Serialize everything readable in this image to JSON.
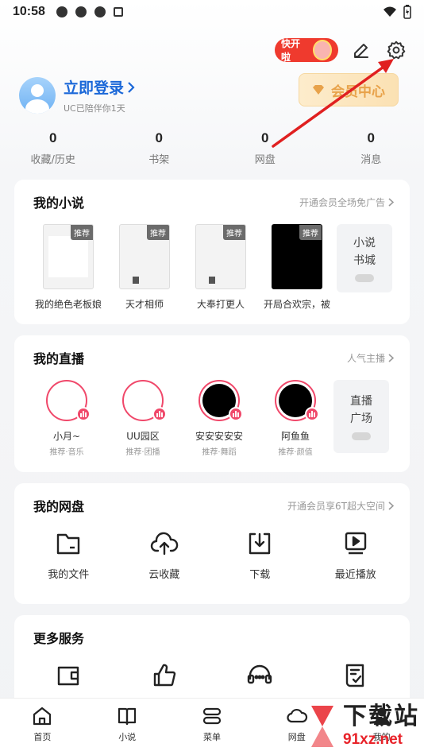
{
  "status": {
    "time": "10:58"
  },
  "header": {
    "promo_label": "快开啦",
    "login_label": "立即登录",
    "login_sub": "UC已陪伴你1天",
    "vip_label": "会员中心"
  },
  "stats": [
    {
      "value": "0",
      "label": "收藏/历史"
    },
    {
      "value": "0",
      "label": "书架"
    },
    {
      "value": "0",
      "label": "网盘"
    },
    {
      "value": "0",
      "label": "消息"
    }
  ],
  "novels": {
    "title": "我的小说",
    "link": "开通会员全场免广告",
    "items": [
      {
        "tag": "推荐",
        "name": "我的绝色老板娘"
      },
      {
        "tag": "推荐",
        "name": "天才相师"
      },
      {
        "tag": "推荐",
        "name": "大奉打更人"
      },
      {
        "tag": "推荐",
        "name": "开局合欢宗，被"
      }
    ],
    "more_line1": "小说",
    "more_line2": "书城"
  },
  "live": {
    "title": "我的直播",
    "link": "人气主播",
    "items": [
      {
        "name": "小月~",
        "sub": "推荐·音乐"
      },
      {
        "name": "UU园区",
        "sub": "推荐·团播"
      },
      {
        "name": "安安安安安",
        "sub": "推荐·舞蹈"
      },
      {
        "name": "阿鱼鱼",
        "sub": "推荐·颜值"
      }
    ],
    "more_line1": "直播",
    "more_line2": "广场"
  },
  "disk": {
    "title": "我的网盘",
    "link": "开通会员享6T超大空间",
    "items": [
      {
        "label": "我的文件",
        "icon": "folder-icon"
      },
      {
        "label": "云收藏",
        "icon": "cloud-upload-icon"
      },
      {
        "label": "下载",
        "icon": "download-icon"
      },
      {
        "label": "最近播放",
        "icon": "play-screen-icon"
      }
    ]
  },
  "services": {
    "title": "更多服务",
    "items": [
      {
        "icon": "wallet-icon"
      },
      {
        "icon": "thumbs-up-icon"
      },
      {
        "icon": "headset-icon"
      },
      {
        "icon": "checklist-icon"
      }
    ]
  },
  "nav": [
    {
      "label": "首页",
      "icon": "home-icon"
    },
    {
      "label": "小说",
      "icon": "book-icon"
    },
    {
      "label": "菜单",
      "icon": "menu-icon"
    },
    {
      "label": "网盘",
      "icon": "cloud-icon"
    },
    {
      "label": "我的",
      "icon": "user-icon"
    }
  ],
  "watermark": {
    "line1": "下载站",
    "line2": "91xz.net"
  },
  "colors": {
    "accent_blue": "#1a67d8",
    "live_pink": "#f0486a",
    "vip_gold": "#e8a24a",
    "arrow_red": "#e02020"
  }
}
